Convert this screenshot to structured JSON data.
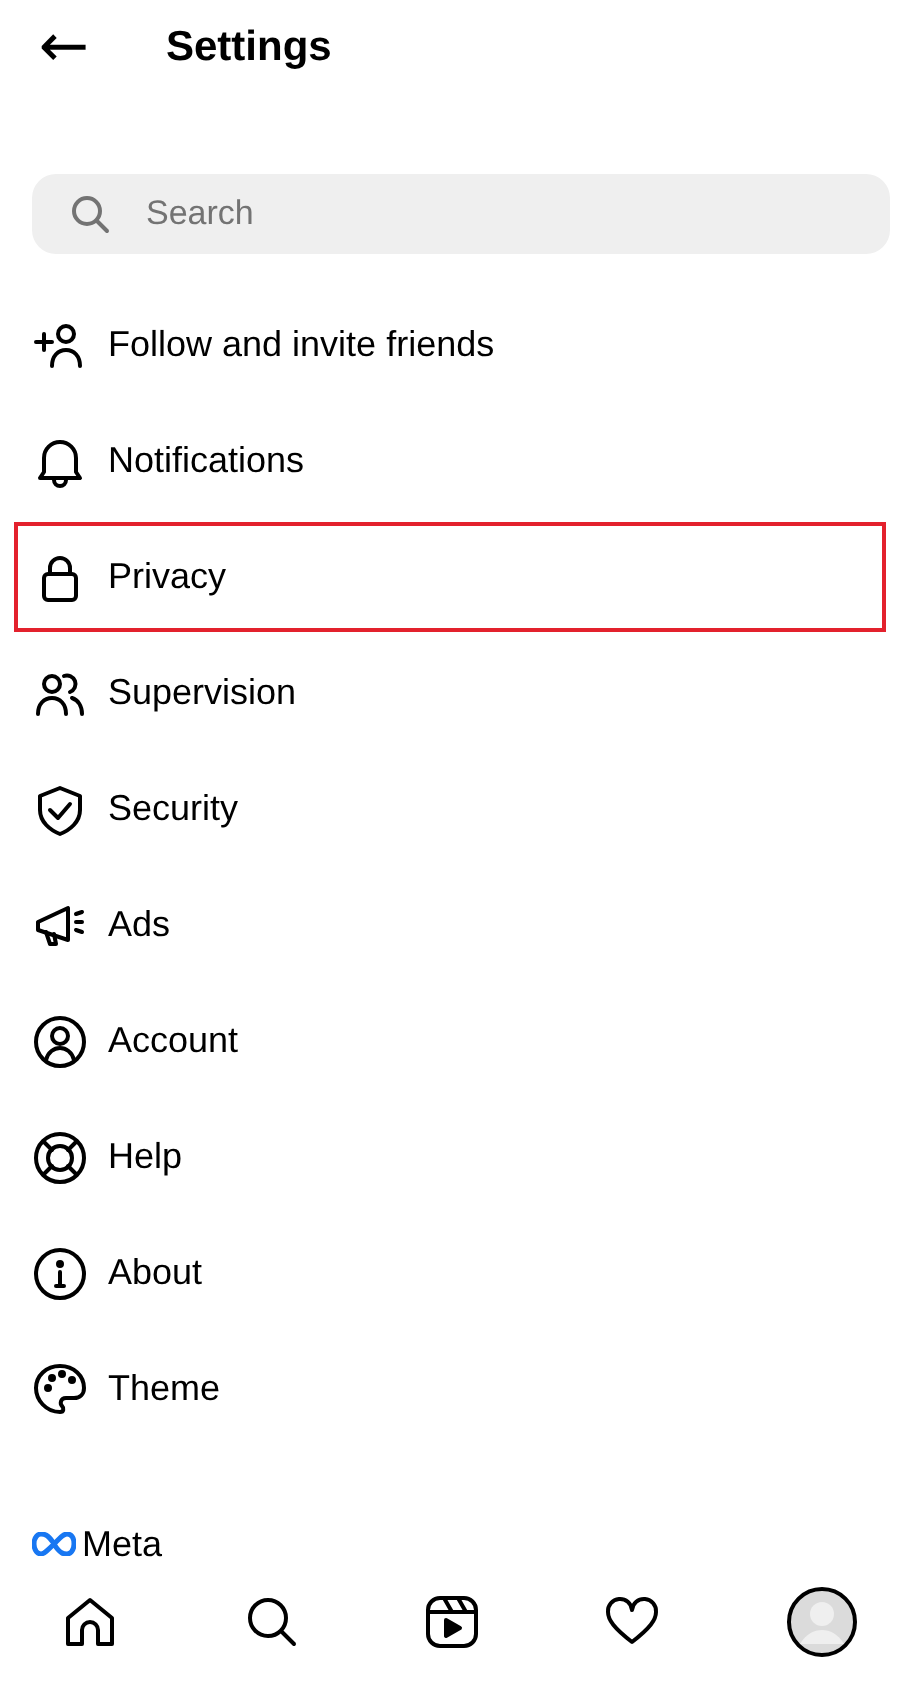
{
  "header": {
    "back": "←",
    "title": "Settings"
  },
  "search": {
    "placeholder": "Search"
  },
  "items": [
    {
      "label": "Follow and invite friends",
      "highlighted": false
    },
    {
      "label": "Notifications",
      "highlighted": false
    },
    {
      "label": "Privacy",
      "highlighted": true
    },
    {
      "label": "Supervision",
      "highlighted": false
    },
    {
      "label": "Security",
      "highlighted": false
    },
    {
      "label": "Ads",
      "highlighted": false
    },
    {
      "label": "Account",
      "highlighted": false
    },
    {
      "label": "Help",
      "highlighted": false
    },
    {
      "label": "About",
      "highlighted": false
    },
    {
      "label": "Theme",
      "highlighted": false
    }
  ],
  "footer": {
    "brand": "Meta"
  }
}
